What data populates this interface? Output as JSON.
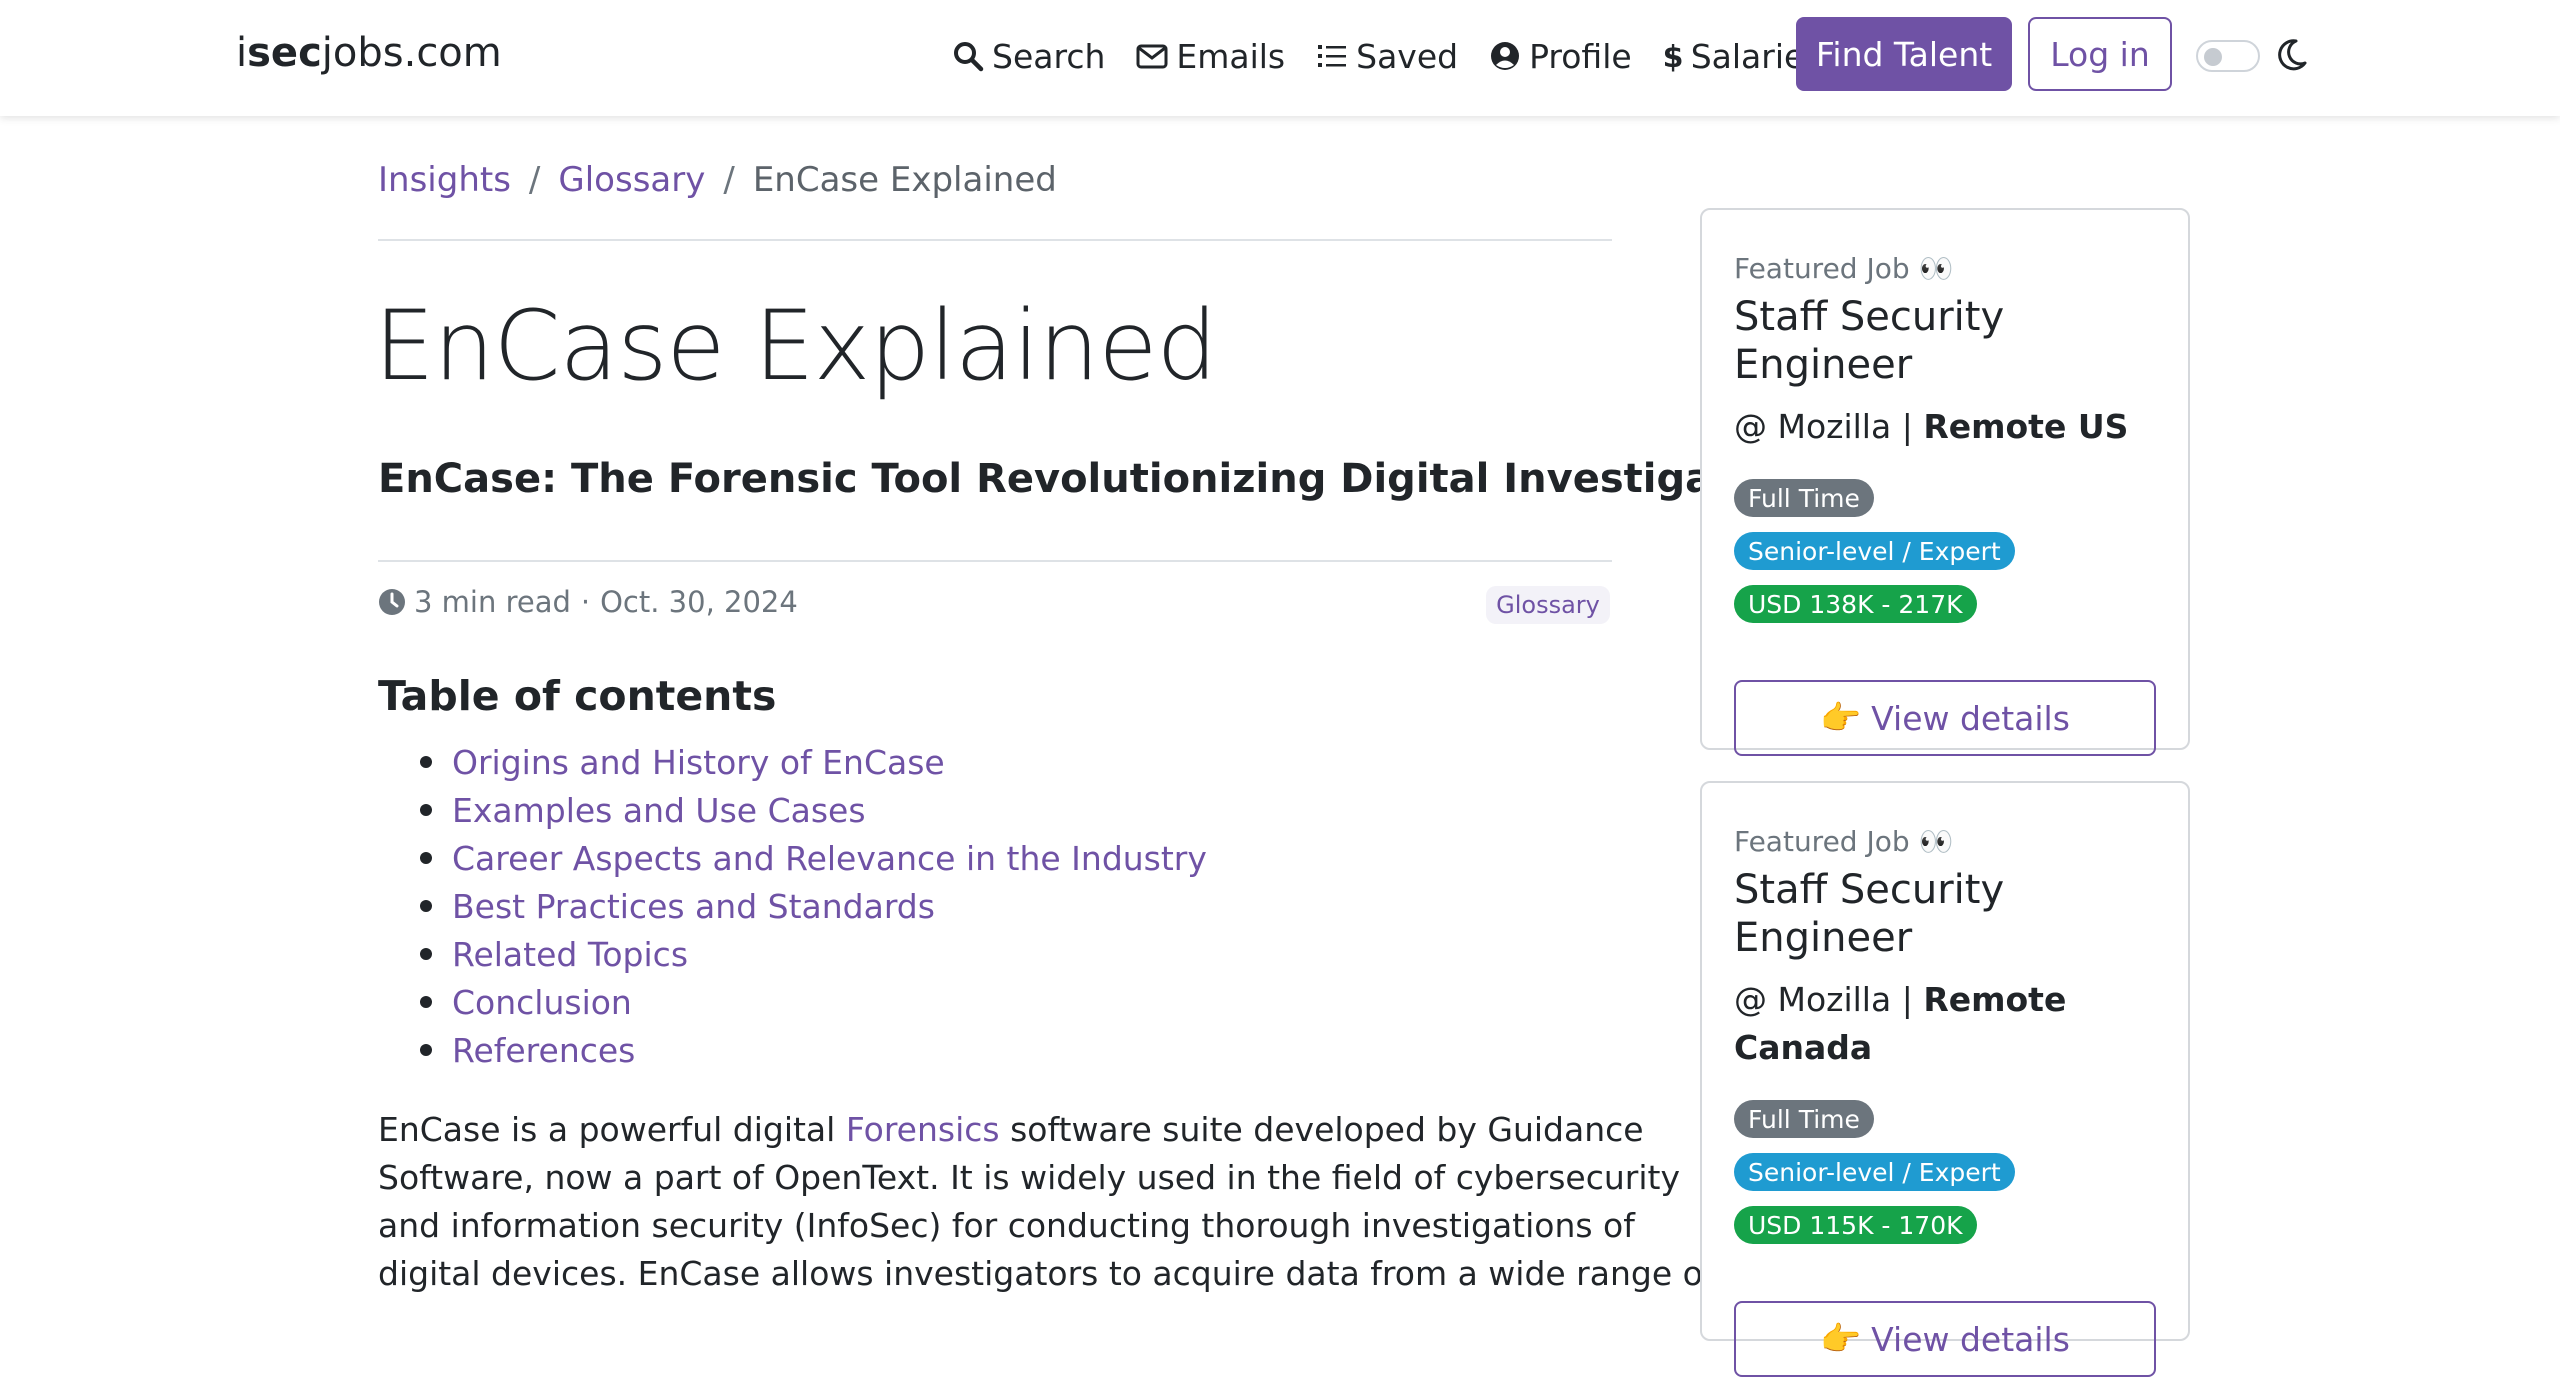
{
  "navbar": {
    "brand_prefix": "i",
    "brand_bold": "sec",
    "brand_suffix": "jobs.com",
    "links": [
      {
        "label": "Search",
        "icon": "search-icon"
      },
      {
        "label": "Emails",
        "icon": "envelope-icon"
      },
      {
        "label": "Saved",
        "icon": "list-icon"
      },
      {
        "label": "Profile",
        "icon": "user-circle-icon"
      },
      {
        "label": "Salaries",
        "icon": "dollar-icon"
      }
    ],
    "find_talent_label": "Find Talent",
    "login_label": "Log in",
    "theme_toggle_icon": "toggle-icon",
    "dark_mode_icon": "moon-icon"
  },
  "breadcrumb": {
    "items": [
      "Insights",
      "Glossary",
      "EnCase Explained"
    ],
    "separator": "/"
  },
  "article": {
    "title": "EnCase Explained",
    "subtitle": "EnCase: The Forensic Tool Revolutionizing Digital Investigations",
    "read_time": "3 min read",
    "meta_separator": "·",
    "date": "Oct. 30, 2024",
    "tag": "Glossary",
    "toc_title": "Table of contents",
    "toc": [
      "Origins and History of EnCase",
      "Examples and Use Cases",
      "Career Aspects and Relevance in the Industry",
      "Best Practices and Standards",
      "Related Topics",
      "Conclusion",
      "References"
    ],
    "body": {
      "line1_before": "EnCase is a powerful digital ",
      "line1_link": "Forensics",
      "line1_after": " software suite developed by Guidance",
      "line2": "Software, now a part of OpenText. It is widely used in the field of cybersecurity",
      "line3": "and information security (InfoSec) for conducting thorough investigations of",
      "line4": "digital devices. EnCase allows investigators to acquire data from a wide range of"
    }
  },
  "sidebar": {
    "jobs": [
      {
        "featured_label": "Featured Job 👀",
        "title": "Staff Security Engineer",
        "company": "@ Mozilla",
        "company_separator": "|",
        "location": "Remote US",
        "badges": [
          "Full Time",
          "Senior-level / Expert",
          "USD 138K - 217K"
        ],
        "button_label": "View details",
        "button_emoji": "👉"
      },
      {
        "featured_label": "Featured Job 👀",
        "title": "Staff Security Engineer",
        "company": "@ Mozilla",
        "company_separator": "|",
        "location": "Remote Canada",
        "badges": [
          "Full Time",
          "Senior-level / Expert",
          "USD 115K - 170K"
        ],
        "button_label": "View details",
        "button_emoji": "👉"
      }
    ]
  },
  "colors": {
    "accent": "#6f52a5",
    "badge_gray": "#6c757d",
    "badge_blue": "#1f9bd1",
    "badge_green": "#16a34a"
  }
}
